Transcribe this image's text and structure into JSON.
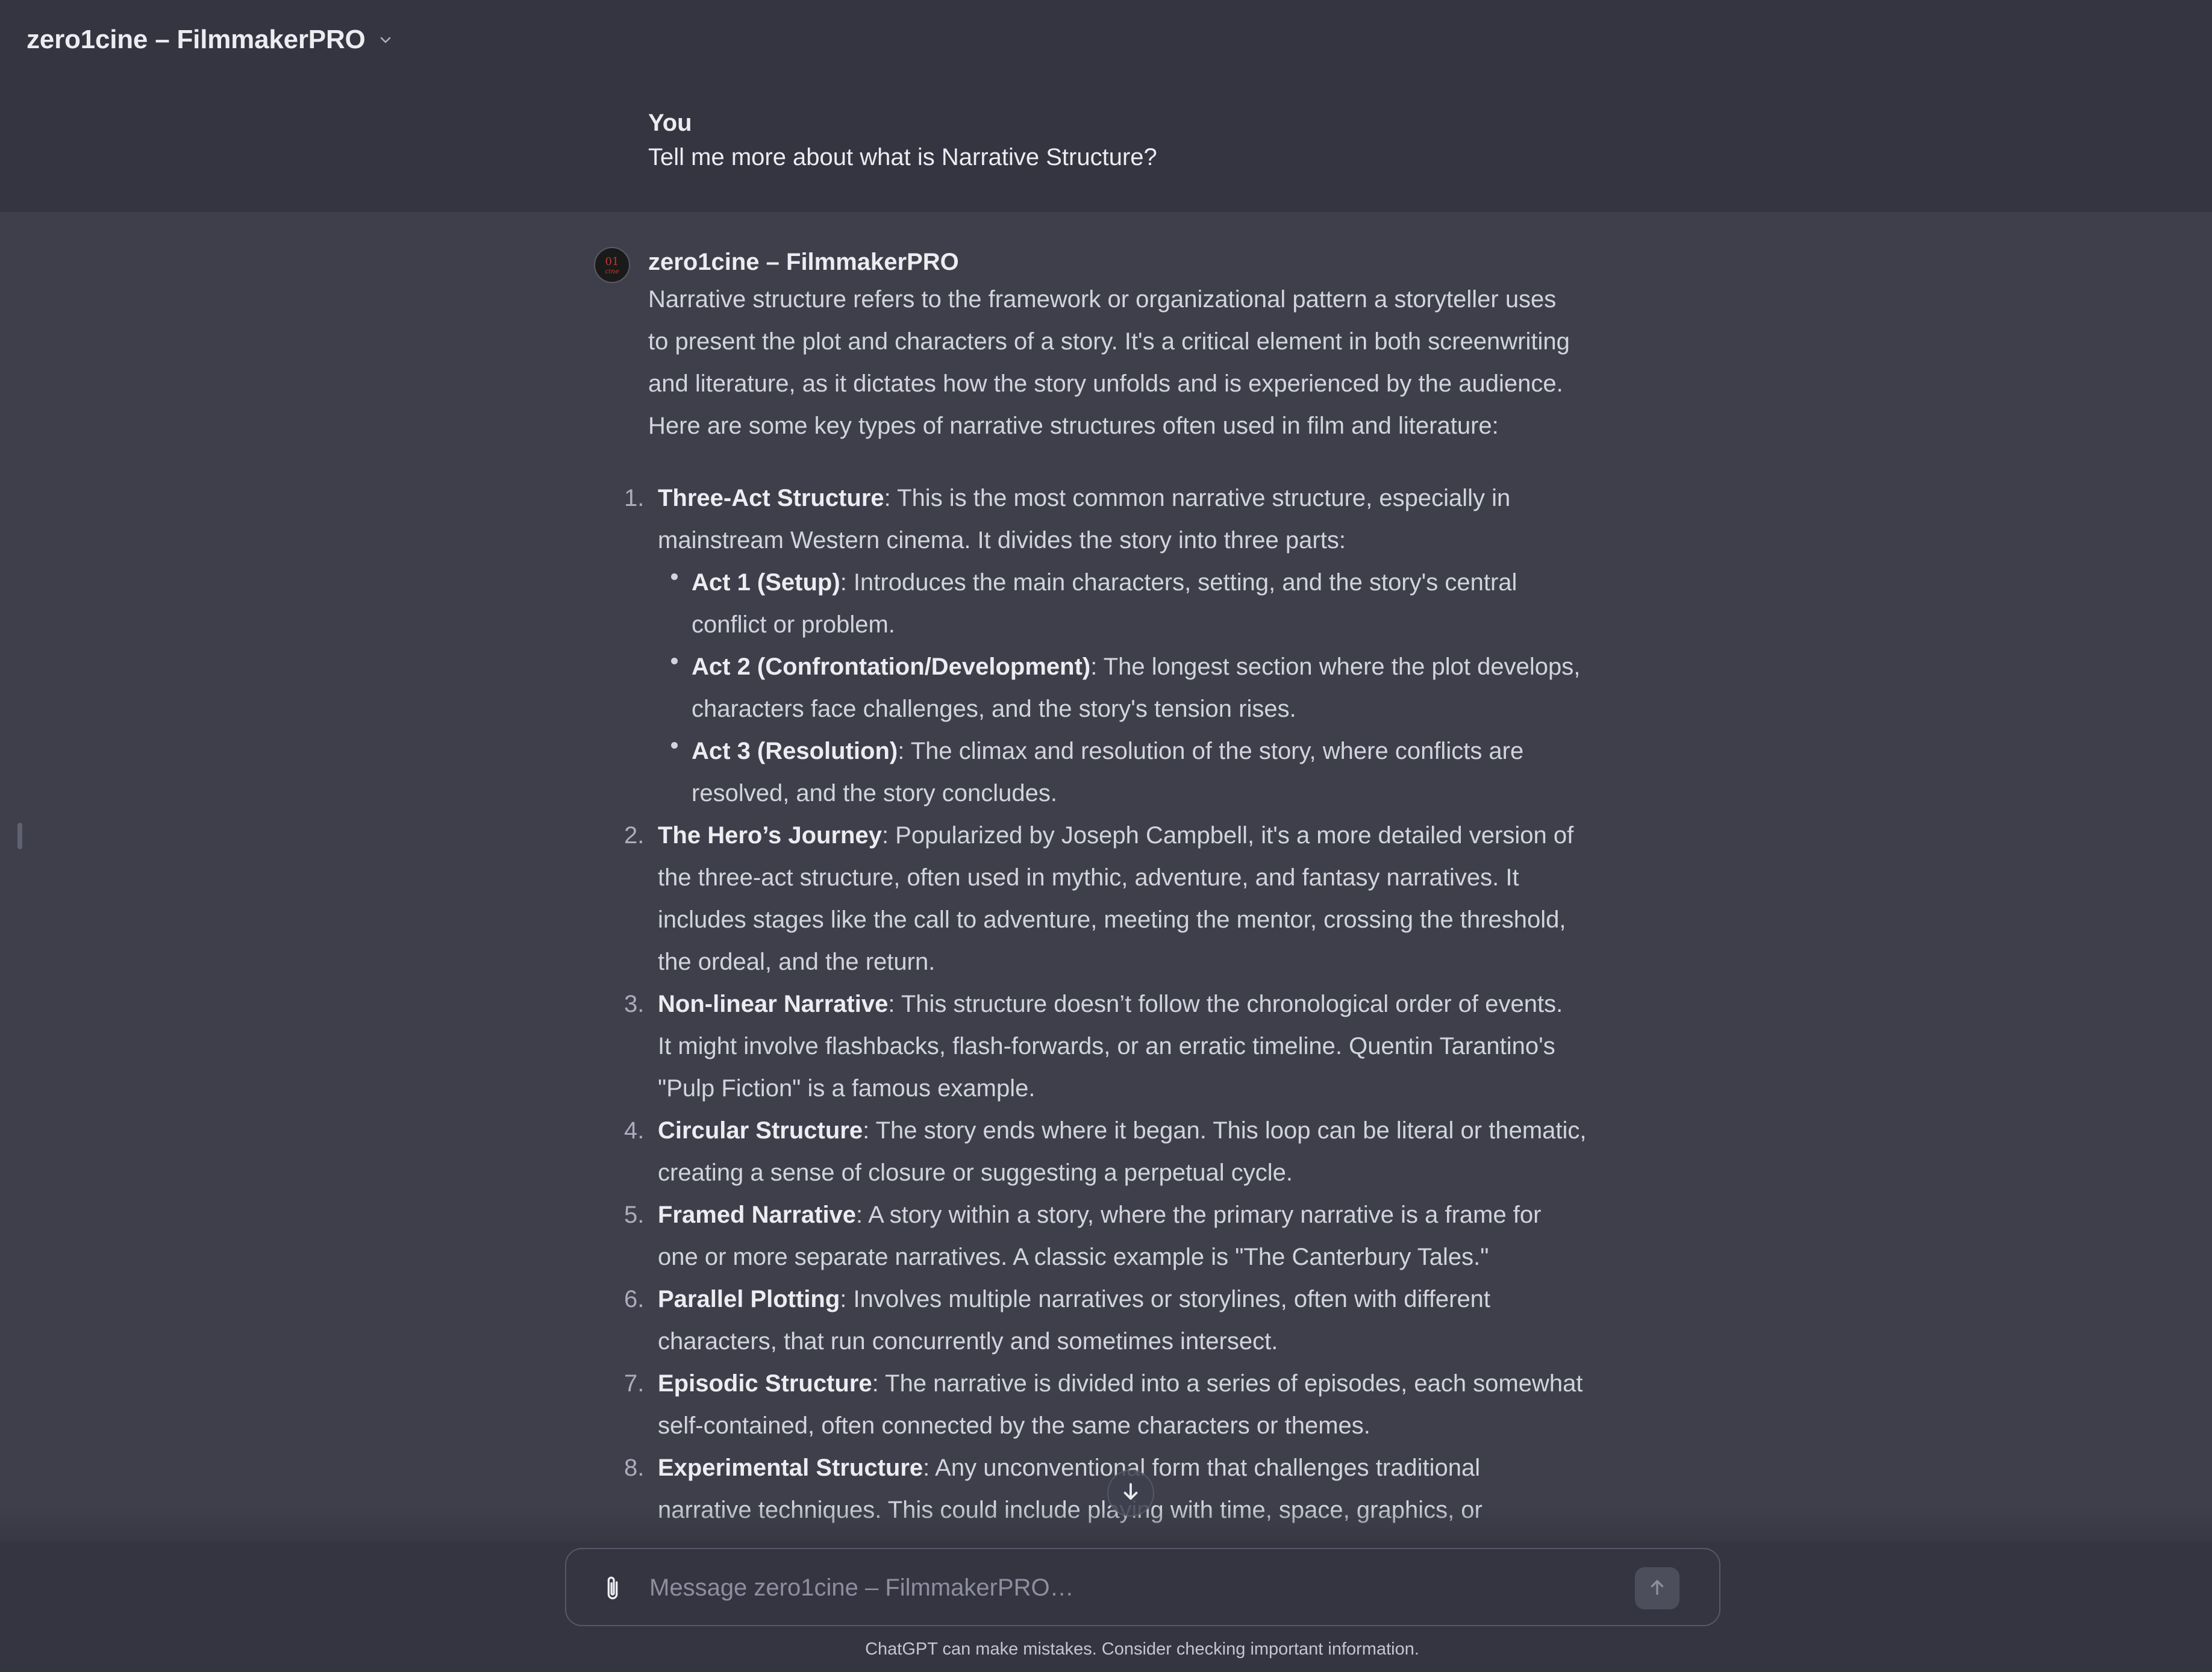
{
  "header": {
    "title": "zero1cine – FilmmakerPRO"
  },
  "user_message": {
    "author": "You",
    "text": "Tell me more about what is Narrative Structure?"
  },
  "assistant_message": {
    "author": "zero1cine – FilmmakerPRO",
    "avatar_text": "01",
    "avatar_subtext": "cine",
    "intro": [
      "Narrative structure refers to the framework or organizational pattern a storyteller uses",
      "to present the plot and characters of a story. It's a critical element in both screenwriting",
      "and literature, as it dictates how the story unfolds and is experienced by the audience.",
      "Here are some key types of narrative structures often used in film and literature:"
    ],
    "items": [
      {
        "num": "1.",
        "title": "Three-Act Structure",
        "lines": [
          ": This is the most common narrative structure, especially in",
          "mainstream Western cinema. It divides the story into three parts:"
        ],
        "subitems": [
          {
            "title": "Act 1 (Setup)",
            "lines": [
              ": Introduces the main characters, setting, and the story's central",
              "conflict or problem."
            ]
          },
          {
            "title": "Act 2 (Confrontation/Development)",
            "lines": [
              ": The longest section where the plot develops,",
              "characters face challenges, and the story's tension rises."
            ]
          },
          {
            "title": "Act 3 (Resolution)",
            "lines": [
              ": The climax and resolution of the story, where conflicts are",
              "resolved, and the story concludes."
            ]
          }
        ]
      },
      {
        "num": "2.",
        "title": "The Hero’s Journey",
        "lines": [
          ": Popularized by Joseph Campbell, it's a more detailed version of",
          "the three-act structure, often used in mythic, adventure, and fantasy narratives. It",
          "includes stages like the call to adventure, meeting the mentor, crossing the threshold,",
          "the ordeal, and the return."
        ]
      },
      {
        "num": "3.",
        "title": "Non-linear Narrative",
        "lines": [
          ": This structure doesn’t follow the chronological order of events.",
          "It might involve flashbacks, flash-forwards, or an erratic timeline. Quentin Tarantino's",
          "\"Pulp Fiction\" is a famous example."
        ]
      },
      {
        "num": "4.",
        "title": "Circular Structure",
        "lines": [
          ": The story ends where it began. This loop can be literal or thematic,",
          "creating a sense of closure or suggesting a perpetual cycle."
        ]
      },
      {
        "num": "5.",
        "title": "Framed Narrative",
        "lines": [
          ": A story within a story, where the primary narrative is a frame for",
          "one or more separate narratives. A classic example is \"The Canterbury Tales.\""
        ]
      },
      {
        "num": "6.",
        "title": "Parallel Plotting",
        "lines": [
          ": Involves multiple narratives or storylines, often with different",
          "characters, that run concurrently and sometimes intersect."
        ]
      },
      {
        "num": "7.",
        "title": "Episodic Structure",
        "lines": [
          ": The narrative is divided into a series of episodes, each somewhat",
          "self-contained, often connected by the same characters or themes."
        ]
      },
      {
        "num": "8.",
        "title": "Experimental Structure",
        "lines": [
          ": Any unconventional form that challenges traditional",
          "narrative techniques. This could include playing with time, space, graphics, or"
        ]
      }
    ]
  },
  "composer": {
    "placeholder": "Message zero1cine – FilmmakerPRO…",
    "value": ""
  },
  "footer": {
    "disclaimer": "ChatGPT can make mistakes. Consider checking important information."
  },
  "icons": {
    "header_dropdown": "chevron-down-icon",
    "attach": "paperclip-icon",
    "send": "arrow-up-icon",
    "scroll": "arrow-down-icon"
  },
  "colors": {
    "background": "#343541",
    "assistant_background": "#3e3f4b",
    "text": "#ececf1",
    "muted_text": "#d1d5db",
    "avatar_accent": "#c0392b"
  }
}
